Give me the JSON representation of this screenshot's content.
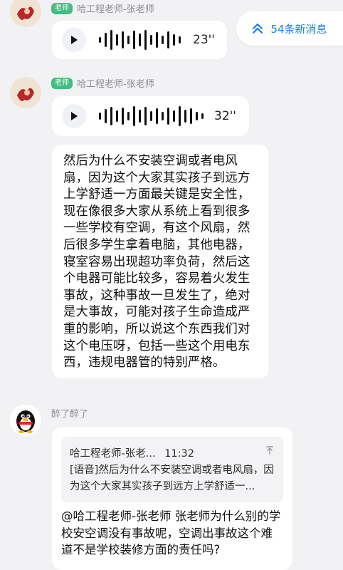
{
  "header": {
    "new_messages": "54条新消息"
  },
  "messages": [
    {
      "sender": "哈工程老师-张老师",
      "role": "老师",
      "voice_duration": "23''"
    },
    {
      "sender": "哈工程老师-张老师",
      "role": "老师",
      "voice_duration": "32''",
      "transcript": "然后为什么不安装空调或者电风扇，因为这个大家其实孩子到远方上学舒适一方面最关键是安全性，现在像很多大家从系统上看到很多一些学校有空调，有这个风扇，然后很多学生拿着电脑，其他电器，寝室容易出现超功率负荷，然后这个电器可能比较多，容易着火发生事故，这种事故一旦发生了，绝对是大事故，可能对孩子生命造成严重的影响，所以说这个东西我们对这个电压呀，包括一些这个用电东西，违规电器管的特别严格。"
    },
    {
      "sender": "醉了醉了",
      "quote": {
        "title": "哈工程老师-张老...",
        "time": "11:32",
        "body": "[语音]然后为什么不安装空调或者电风扇，因为这个大家其实孩子到远方上学舒适一..."
      },
      "reply": "@哈工程老师-张老师 张老师为什么别的学校安空调没有事故呢，空调出事故这个难道不是学校装修方面的责任吗?"
    }
  ],
  "icons": {
    "badge_color": "#3fbf7f",
    "accent": "#1b7ff0"
  }
}
